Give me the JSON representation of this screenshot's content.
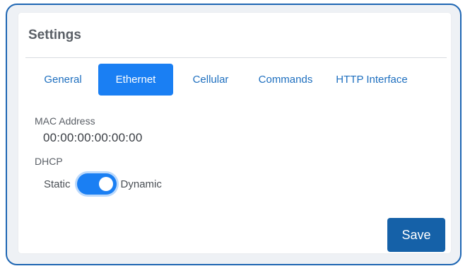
{
  "settings": {
    "title": "Settings",
    "tabs": [
      {
        "label": "General",
        "active": false
      },
      {
        "label": "Ethernet",
        "active": true
      },
      {
        "label": "Cellular",
        "active": false
      },
      {
        "label": "Commands",
        "active": false
      },
      {
        "label": "HTTP Interface",
        "active": false
      }
    ],
    "mac": {
      "label": "MAC Address",
      "value": "00:00:00:00:00:00"
    },
    "dhcp": {
      "label": "DHCP",
      "off_label": "Static",
      "on_label": "Dynamic",
      "enabled": true
    },
    "save_label": "Save"
  },
  "colors": {
    "accent": "#1a7ff3",
    "frame_border": "#1e66b3",
    "save_button": "#1561a8",
    "tab_text": "#1e6fbf"
  }
}
